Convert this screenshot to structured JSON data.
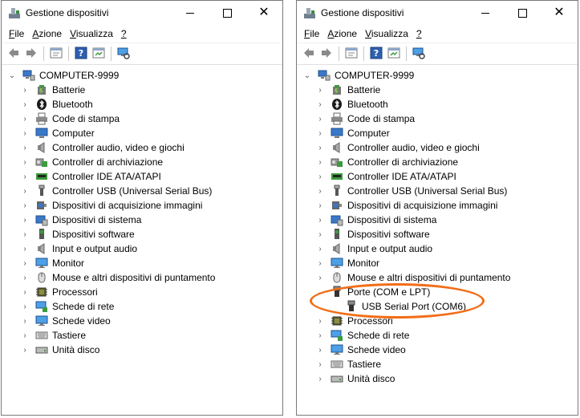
{
  "window": {
    "title": "Gestione dispositivi",
    "close_glyph": "✕"
  },
  "menu": [
    {
      "first": "F",
      "rest": "ile"
    },
    {
      "first": "A",
      "rest": "zione"
    },
    {
      "first": "V",
      "rest": "isualizza"
    },
    {
      "first": "?",
      "rest": ""
    }
  ],
  "toolbar": [
    "back-arrow-icon",
    "forward-arrow-icon",
    "properties-icon",
    "help-icon",
    "update-driver-icon",
    "monitor-scan-icon"
  ],
  "root": "COMPUTER-9999",
  "left_categories": [
    {
      "label": "Batterie",
      "icon": "battery"
    },
    {
      "label": "Bluetooth",
      "icon": "bluetooth"
    },
    {
      "label": "Code di stampa",
      "icon": "printer"
    },
    {
      "label": "Computer",
      "icon": "computer"
    },
    {
      "label": "Controller audio, video e giochi",
      "icon": "speaker"
    },
    {
      "label": "Controller di archiviazione",
      "icon": "storage"
    },
    {
      "label": "Controller IDE ATA/ATAPI",
      "icon": "ide"
    },
    {
      "label": "Controller USB (Universal Serial Bus)",
      "icon": "usb"
    },
    {
      "label": "Dispositivi di acquisizione immagini",
      "icon": "camera"
    },
    {
      "label": "Dispositivi di sistema",
      "icon": "system"
    },
    {
      "label": "Dispositivi software",
      "icon": "software"
    },
    {
      "label": "Input e output audio",
      "icon": "speaker"
    },
    {
      "label": "Monitor",
      "icon": "monitor"
    },
    {
      "label": "Mouse e altri dispositivi di puntamento",
      "icon": "mouse"
    },
    {
      "label": "Processori",
      "icon": "cpu"
    },
    {
      "label": "Schede di rete",
      "icon": "network"
    },
    {
      "label": "Schede video",
      "icon": "monitor"
    },
    {
      "label": "Tastiere",
      "icon": "keyboard"
    },
    {
      "label": "Unità disco",
      "icon": "disk"
    }
  ],
  "right_categories": [
    {
      "label": "Batterie",
      "icon": "battery"
    },
    {
      "label": "Bluetooth",
      "icon": "bluetooth"
    },
    {
      "label": "Code di stampa",
      "icon": "printer"
    },
    {
      "label": "Computer",
      "icon": "computer"
    },
    {
      "label": "Controller audio, video e giochi",
      "icon": "speaker"
    },
    {
      "label": "Controller di archiviazione",
      "icon": "storage"
    },
    {
      "label": "Controller IDE ATA/ATAPI",
      "icon": "ide"
    },
    {
      "label": "Controller USB (Universal Serial Bus)",
      "icon": "usb"
    },
    {
      "label": "Dispositivi di acquisizione immagini",
      "icon": "camera"
    },
    {
      "label": "Dispositivi di sistema",
      "icon": "system"
    },
    {
      "label": "Dispositivi software",
      "icon": "software"
    },
    {
      "label": "Input e output audio",
      "icon": "speaker"
    },
    {
      "label": "Monitor",
      "icon": "monitor"
    },
    {
      "label": "Mouse e altri dispositivi di puntamento",
      "icon": "mouse"
    },
    {
      "label": "Porte (COM e LPT)",
      "icon": "port",
      "expanded": true,
      "children": [
        {
          "label": "USB Serial Port (COM6)",
          "icon": "port"
        }
      ]
    },
    {
      "label": "Processori",
      "icon": "cpu"
    },
    {
      "label": "Schede di rete",
      "icon": "network"
    },
    {
      "label": "Schede video",
      "icon": "monitor"
    },
    {
      "label": "Tastiere",
      "icon": "keyboard"
    },
    {
      "label": "Unità disco",
      "icon": "disk"
    }
  ],
  "colors": {
    "highlight": "#f26d16",
    "accent": "#2e6fc4"
  }
}
